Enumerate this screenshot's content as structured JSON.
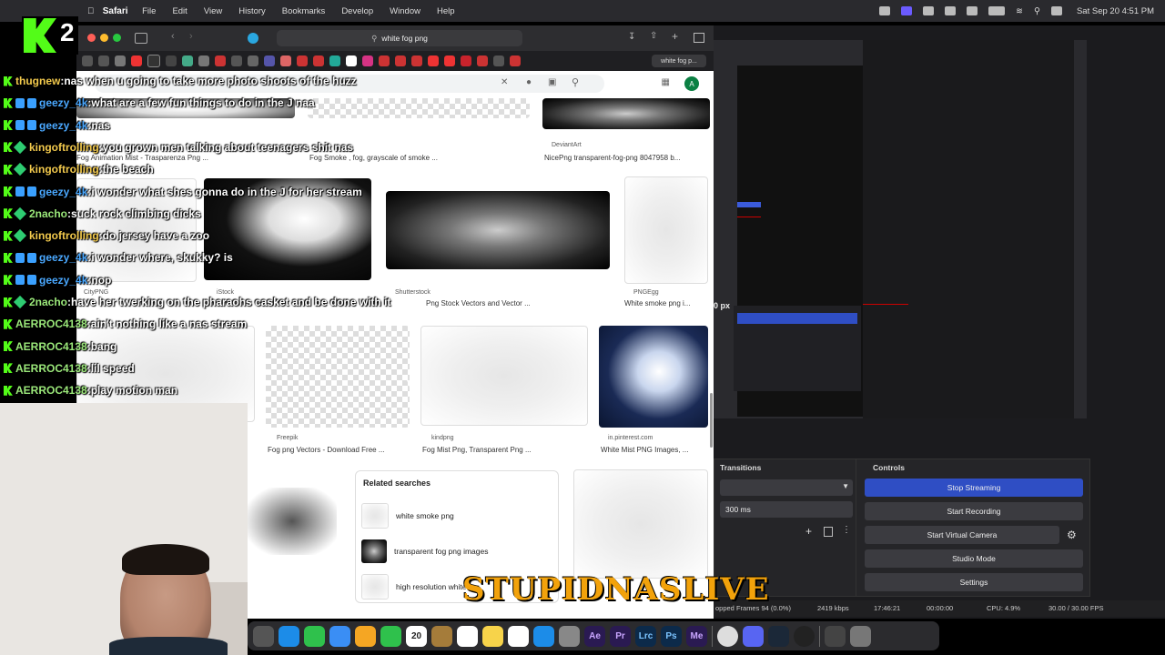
{
  "menubar": {
    "app": "Safari",
    "items": [
      "File",
      "Edit",
      "View",
      "History",
      "Bookmarks",
      "Develop",
      "Window",
      "Help"
    ],
    "clock": "Sat Sep 20  4:51 PM"
  },
  "safari": {
    "url": "white fog png",
    "tab_label": "white fog p...",
    "avatar": "A"
  },
  "results": [
    {
      "caption": "Fog Animation Mist - Trasparenza Png ..."
    },
    {
      "caption": "Fog Smoke , fog, grayscale of smoke ..."
    },
    {
      "source": "DeviantArt",
      "caption": "NicePng transparent-fog-png 8047958 b..."
    },
    {
      "source": "CityPNG",
      "caption": ""
    },
    {
      "source": "iStock",
      "caption": ""
    },
    {
      "source": "Shutterstock",
      "caption": "Png Stock Vectors and Vector ..."
    },
    {
      "source": "PNGEgg",
      "caption": "White smoke png i..."
    },
    {
      "source": "Freepik",
      "caption": "Fog png Vectors - Download Free ..."
    },
    {
      "source": "kindpng",
      "caption": "Fog Mist Png, Transparent Png ..."
    },
    {
      "source": "in.pinterest.com",
      "caption": "White Mist PNG Images, ..."
    }
  ],
  "related": {
    "title": "Related searches",
    "items": [
      "white smoke png",
      "transparent fog png images",
      "high resolution white fog"
    ]
  },
  "obs": {
    "transitions_label": "Transitions",
    "controls_label": "Controls",
    "duration": "300 ms",
    "buttons": [
      "Stop Streaming",
      "Start Recording",
      "Start Virtual Camera",
      "Studio Mode",
      "Settings"
    ],
    "status": {
      "dropped": "opped Frames 94 (0.0%)",
      "bitrate": "2419 kbps",
      "live_time": "17:46:21",
      "rec_time": "00:00:00",
      "cpu": "CPU: 4.9%",
      "fps": "30.00 / 30.00 FPS"
    },
    "px_label": "0 px"
  },
  "logo": {
    "number": "2"
  },
  "chat": [
    {
      "user": "thugnew",
      "color": "#f2c94c",
      "msg": "nas when u going to take more photo shoots of the huzz",
      "badges": [
        "kick"
      ]
    },
    {
      "user": "geezy_4k",
      "color": "#4aa8ff",
      "msg": "what are a few fun things to do in the J naa",
      "badges": [
        "kick",
        "badge",
        "badge"
      ]
    },
    {
      "user": "geezy_4k",
      "color": "#4aa8ff",
      "msg": "nas",
      "badges": [
        "kick",
        "badge",
        "badge"
      ]
    },
    {
      "user": "kingoftrolling",
      "color": "#f2c94c",
      "msg": "you grown men talking about teenagers shit nas",
      "badges": [
        "kick",
        "diamond"
      ]
    },
    {
      "user": "kingoftrolling",
      "color": "#f2c94c",
      "msg": "the beach",
      "badges": [
        "kick",
        "diamond"
      ]
    },
    {
      "user": "geezy_4k",
      "color": "#4aa8ff",
      "msg": "i wonder what shes gonna do in the J for her stream",
      "badges": [
        "kick",
        "badge",
        "badge"
      ]
    },
    {
      "user": "2nacho",
      "color": "#9be87a",
      "msg": "suck rock climbing dicks",
      "badges": [
        "kick",
        "diamond"
      ]
    },
    {
      "user": "kingoftrolling",
      "color": "#f2c94c",
      "msg": "do jersey have a zoo",
      "badges": [
        "kick",
        "diamond"
      ]
    },
    {
      "user": "geezy_4k",
      "color": "#4aa8ff",
      "msg": "i wonder where, skukky? is",
      "badges": [
        "kick",
        "badge",
        "badge"
      ]
    },
    {
      "user": "geezy_4k",
      "color": "#4aa8ff",
      "msg": "nop",
      "badges": [
        "kick",
        "badge",
        "badge"
      ]
    },
    {
      "user": "2nacho",
      "color": "#9be87a",
      "msg": "have her twerking on the pharaohs casket and be done with it",
      "badges": [
        "kick",
        "diamond"
      ]
    },
    {
      "user": "AERROC4138",
      "color": "#9be87a",
      "msg": "ain't nothing like a nas stream",
      "badges": [
        "kick"
      ]
    },
    {
      "user": "AERROC4138",
      "color": "#9be87a",
      "msg": "bang",
      "badges": [
        "kick"
      ]
    },
    {
      "user": "AERROC4138",
      "color": "#9be87a",
      "msg": "lil speed",
      "badges": [
        "kick"
      ]
    },
    {
      "user": "AERROC4138",
      "color": "#9be87a",
      "msg": "play motion man",
      "badges": [
        "kick"
      ]
    }
  ],
  "brand_text": "STUPIDNASLIVE",
  "dock": {
    "calendar_day": "20",
    "apps": [
      {
        "name": "Ae",
        "color": "#2a1a52"
      },
      {
        "name": "Pr",
        "color": "#2a1a52"
      },
      {
        "name": "Lrc",
        "color": "#0c2a4a"
      },
      {
        "name": "Ps",
        "color": "#0c2a4a"
      },
      {
        "name": "Me",
        "color": "#2a1a52"
      }
    ]
  }
}
